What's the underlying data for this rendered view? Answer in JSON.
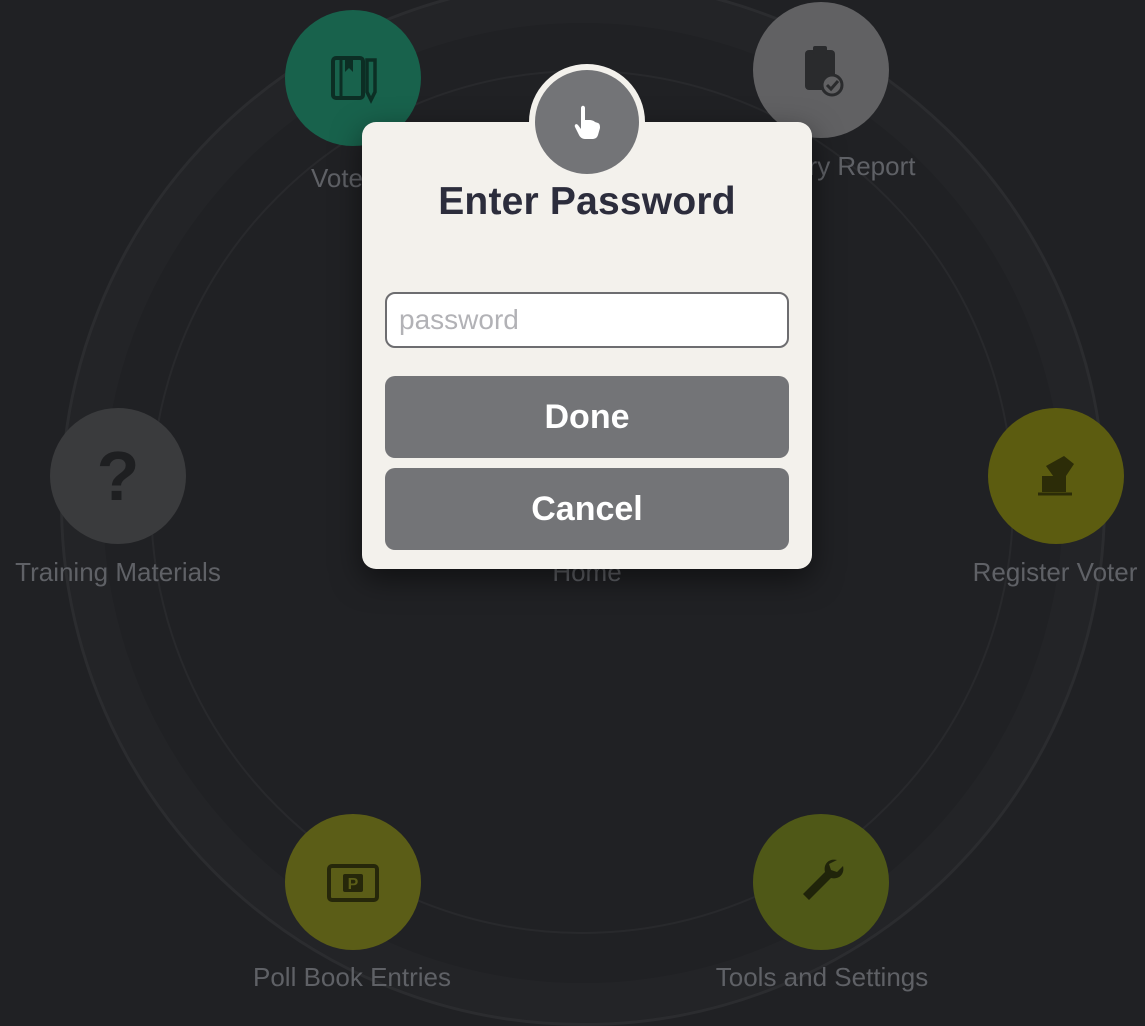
{
  "apps": {
    "voter_lookup": {
      "label": "Vote",
      "color": "#18624c",
      "icon": "book-icon"
    },
    "summary_report": {
      "label": "ry Report",
      "color": "#616163",
      "icon": "clipboard-check-icon"
    },
    "training_materials": {
      "label": "Training Materials",
      "color": "#3a3b3d",
      "icon": "question-mark-icon",
      "glyph": "?"
    },
    "home": {
      "label": "Home"
    },
    "register_voter": {
      "label": "Register Voter",
      "color": "#5c5c10",
      "icon": "hand-ballot-icon"
    },
    "poll_book_entries": {
      "label": "Poll Book Entries",
      "color": "#5b5d17",
      "icon": "tablet-icon"
    },
    "tools_settings": {
      "label": "Tools and Settings",
      "color": "#4f5817",
      "icon": "wrench-icon"
    }
  },
  "dialog": {
    "icon": "pointer-hand-icon",
    "title": "Enter Password",
    "password_placeholder": "password",
    "password_value": "",
    "done_label": "Done",
    "cancel_label": "Cancel",
    "background_color": "#f3f1ec",
    "button_color": "#737477"
  }
}
